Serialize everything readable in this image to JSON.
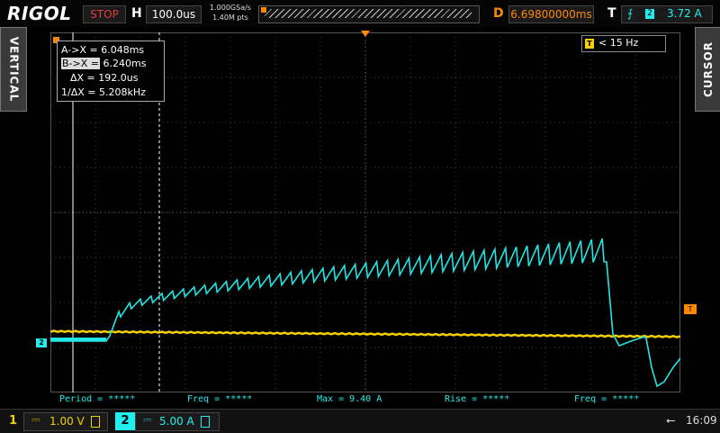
{
  "header": {
    "brand": "RIGOL",
    "run_status": "STOP",
    "timebase_label": "H",
    "timebase_value": "100.0us",
    "sample_rate": "1.000GSa/s",
    "memory_points": "1.40M pts",
    "delay_label": "D",
    "delay_value": "6.69800000ms",
    "trigger_label": "T",
    "trigger_edge_icon": "rising-edge-icon",
    "trigger_source": "2",
    "trigger_level": "3.72 A"
  },
  "side_tabs": {
    "left": "VERTICAL",
    "right": "CURSOR"
  },
  "cursor_readout": {
    "ax": "A->X = 6.048ms",
    "bx_label": "B->X =",
    "bx_value": "6.240ms",
    "dx": "ΔX = 192.0us",
    "inv_dx": "1/ΔX = 5.208kHz"
  },
  "freq_counter": {
    "icon": "T",
    "value": "< 15 Hz"
  },
  "markers": {
    "trigger_level": "T",
    "ch2": "2"
  },
  "measurements": [
    {
      "label": "Period = *****"
    },
    {
      "label": "Freq = *****"
    },
    {
      "label": "Max = 9.40 A"
    },
    {
      "label": "Rise = *****"
    },
    {
      "label": "Freq = *****"
    }
  ],
  "channels": {
    "ch1": {
      "number": "1",
      "coupling": "⎓",
      "scale": "1.00 V",
      "color": "#f4d000"
    },
    "ch2": {
      "number": "2",
      "coupling": "⎓",
      "scale": "5.00 A",
      "color": "#22e5e5"
    }
  },
  "status": {
    "usb_icon": "usb-icon",
    "time": "16:09"
  },
  "colors": {
    "ch1": "#f4d000",
    "ch2": "#22e5e5",
    "trigger": "#ff8800",
    "grid": "#555555"
  },
  "waveforms": {
    "ch1_level_divs": 1.35,
    "ch2_baseline_divs": 1.1,
    "ch2_peak_A": 9.4,
    "ramp_teeth": 46
  }
}
